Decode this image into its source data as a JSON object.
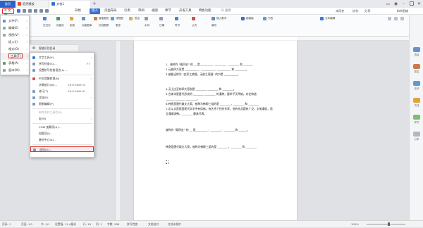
{
  "titlebar": {
    "home_tab": "首页",
    "tabs": [
      "稻壳模板",
      "文档1"
    ],
    "add_tab": "+"
  },
  "menubar": {
    "file_label": "≡ 文件",
    "items": [
      "开始",
      "插入",
      "页面布局",
      "引用",
      "审阅",
      "视图",
      "章节",
      "开发工具",
      "特色功能"
    ],
    "active_item": "插入",
    "search_placeholder": "Q 查找",
    "right": [
      "未同步",
      "协作",
      "分享"
    ],
    "user": "Kell图城"
  },
  "ribbon": {
    "row1": [
      "分页",
      "表格",
      "图片",
      "截屏",
      "形状",
      "图标",
      "图表",
      "智能图形",
      "流程图",
      "思维导图",
      "批注",
      "页眉和页脚",
      "页码",
      "文本框",
      "艺术字",
      "插入数字",
      "对象",
      "文件对象",
      "超链接",
      "书签",
      "交叉引用",
      "文本编辑"
    ],
    "row2": [
      "空白页",
      "封面页",
      "稻壳",
      "功能图库",
      "在线图表",
      "更多",
      "水印",
      "日期",
      "符号",
      "公式",
      "编号"
    ]
  },
  "file_menu": {
    "items": [
      {
        "label": "文件(F)",
        "arrow": "›"
      },
      {
        "label": "编辑(E)",
        "arrow": "›"
      },
      {
        "label": "视图(V)",
        "arrow": "›"
      },
      {
        "label": "插入(I)",
        "arrow": "›"
      },
      {
        "label": "格式(O)",
        "arrow": "›"
      },
      {
        "label": "工具(T)",
        "arrow": "›"
      },
      {
        "label": "表格(A)",
        "arrow": "›"
      },
      {
        "label": "窗口(W)",
        "arrow": "›"
      }
    ],
    "selected_index": 5
  },
  "tools_submenu": {
    "header": "智能识别目录",
    "items": [
      {
        "label": "文字工具(X)",
        "shortcut": "",
        "arrow": "›",
        "disabled": false
      },
      {
        "label": "拼写检查(S)...",
        "shortcut": "F7",
        "arrow": "",
        "disabled": false
      },
      {
        "label": "设置拼写检查语言(L)...",
        "shortcut": "",
        "arrow": "",
        "disabled": false
      },
      {
        "label": "中文简繁转换(N)",
        "shortcut": "",
        "arrow": "›",
        "disabled": false
      },
      {
        "label": "字数统计(W)...",
        "shortcut": "Ctrl+Shift+G",
        "arrow": "",
        "disabled": false
      },
      {
        "label": "修订(T)",
        "shortcut": "Ctrl+Shift+E",
        "arrow": "",
        "disabled": false
      },
      {
        "label": "比较(R)",
        "shortcut": "",
        "arrow": "›",
        "disabled": false
      },
      {
        "label": "限制编辑(P)",
        "shortcut": "",
        "arrow": "",
        "disabled": false
      },
      {
        "label": "邮件合并工具栏(E)",
        "shortcut": "",
        "arrow": "",
        "disabled": true
      },
      {
        "label": "宏(M)",
        "shortcut": "",
        "arrow": "›",
        "disabled": false
      },
      {
        "label": "COM 加载项(A)...",
        "shortcut": "",
        "arrow": "",
        "disabled": false
      },
      {
        "label": "加载项(I)...",
        "shortcut": "",
        "arrow": "",
        "disabled": false
      },
      {
        "label": "备份中心(K)...",
        "shortcut": "",
        "arrow": "",
        "disabled": false
      },
      {
        "label": "选项(O)...",
        "shortcut": "",
        "arrow": "",
        "disabled": false
      }
    ]
  },
  "document": {
    "lines": [
      "1、被称作 \"殿四史\" 的 __ 是_________、________、________ 和 ______。",
      "2.元曲四大家是 __________、__________、__________ 和 ________。",
      "3.被鲁迅称为 \"史家之绝唱，无韵之离骚\" 的书是 __________。",
      "",
      "4.汉士比亚的四大悲剧是 ________ ________ 和 ________。",
      "5.古体诗是唐代形成的 ________ ________ 的通称，要求平仄押韵，对仗和谐",
      "______ ________ ________。",
      "6.韩愈是唐代散文大家，被称为韩柳三组的是 ________，________ 和 ________",
      "7.北斗文是我国现代文学中有风格，有艺术个性的作家，他的作品题材广泛，文笔通俗，语",
      "言通顺流畅。________ 最具代表。",
      "",
      "被称作 \"殿四史\" 的 __ 是_________、________、________ 和 ______。",
      "",
      "",
      "韩愈是唐代散文大家，被称为韩柳三组的是 ________，________ 和 ________"
    ]
  },
  "right_panel": [
    "选择",
    "属性",
    "形状",
    "文档",
    "样式",
    "分享"
  ],
  "statusbar": {
    "items": [
      "页码: 1",
      "页面: 1/1",
      "节: 1/1",
      "设置值: 11.4厘米",
      "行: 18",
      "列: 1",
      "字数: 288",
      "拼写检查",
      "文档校对",
      "文档未保护"
    ],
    "zoom": "100%"
  }
}
